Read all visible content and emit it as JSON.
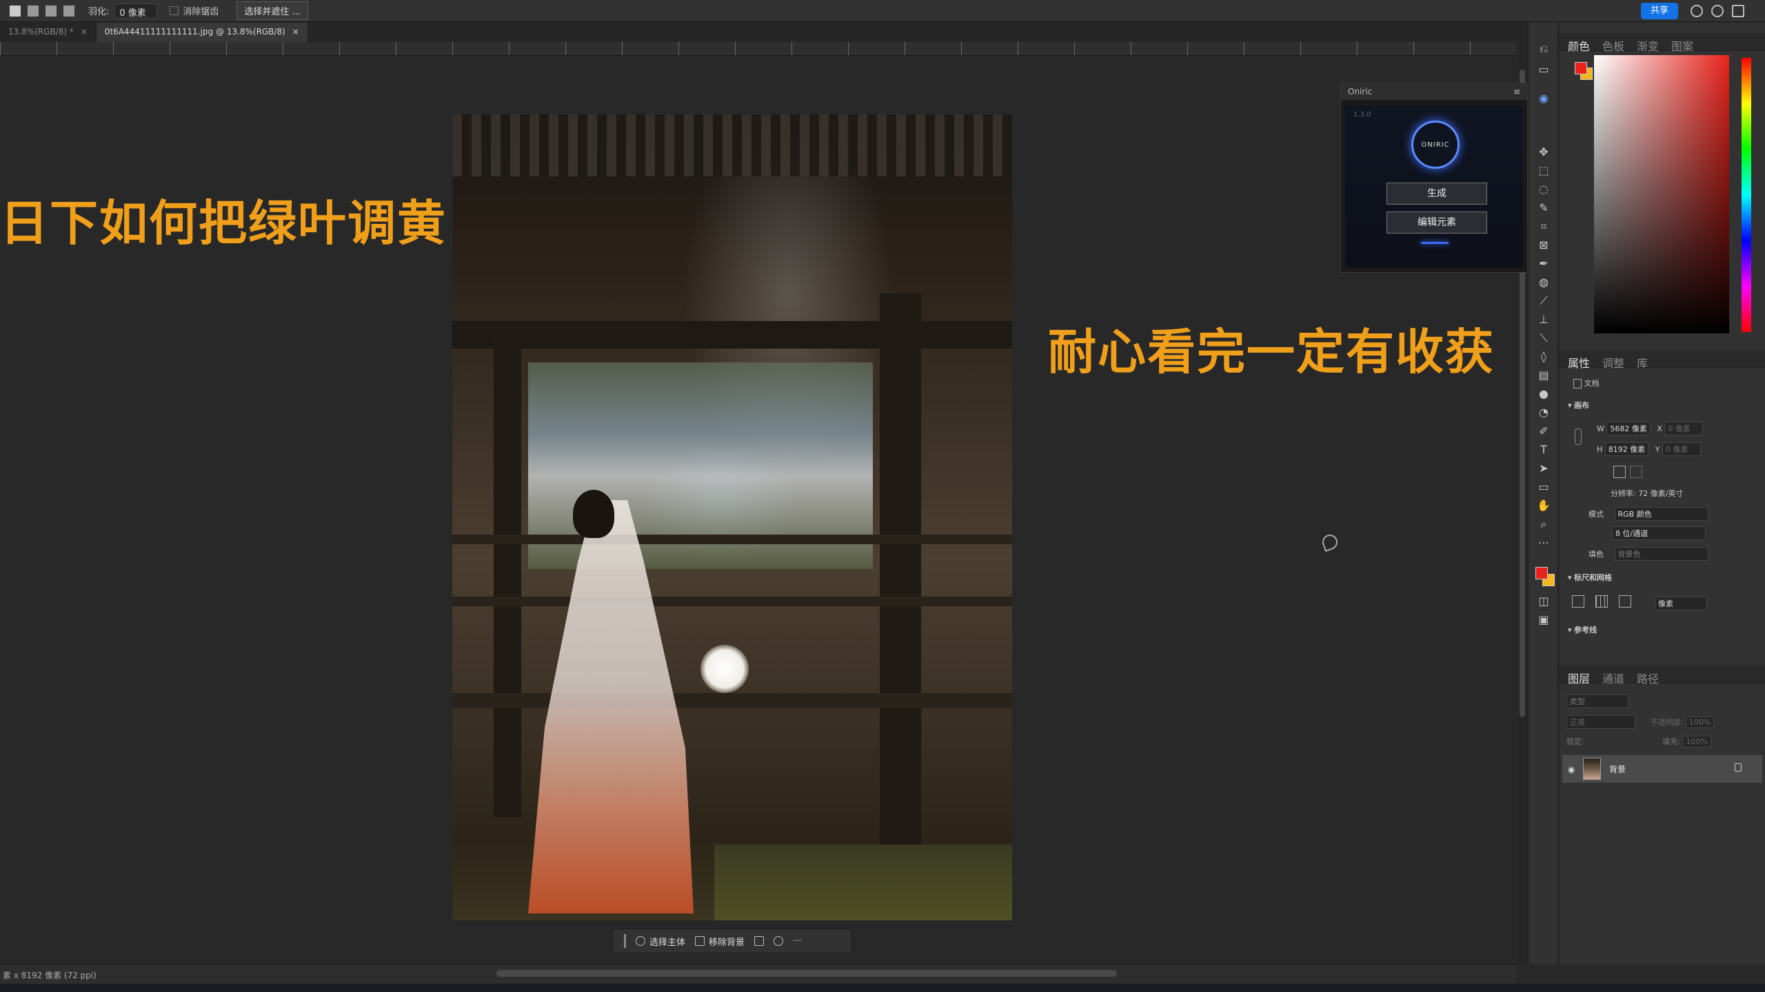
{
  "optbar": {
    "feather_label": "羽化:",
    "feather_value": "0 像素",
    "antialias_label": "消除锯齿",
    "select_mask_button": "选择并遮住 ..."
  },
  "topbar": {
    "share": "共享"
  },
  "tabs": [
    {
      "label": "13.8%(RGB/8) *",
      "close": "×"
    },
    {
      "label": "0t6A44411111111111.jpg @ 13.8%(RGB/8)",
      "close": "×"
    }
  ],
  "overlay": {
    "left_text": "日下如何把绿叶调黄",
    "right_text": "耐心看完一定有收获"
  },
  "context_bar": {
    "select_subject": "选择主体",
    "remove_bg": "移除背景",
    "more": "···"
  },
  "plugin": {
    "title": "Oniric",
    "version": "1.3.0",
    "logo_text": "ONIRIC",
    "generate": "生成",
    "edit_element": "编辑元素"
  },
  "color_panel": {
    "tabs": [
      "颜色",
      "色板",
      "渐变",
      "图案"
    ]
  },
  "properties_panel": {
    "tabs": [
      "属性",
      "调整",
      "库"
    ],
    "doc_label": "文档",
    "canvas_section": "画布",
    "w_label": "W",
    "w_value": "5682 像素",
    "x_label": "X",
    "x_placeholder": "0 像素",
    "h_label": "H",
    "h_value": "8192 像素",
    "y_label": "Y",
    "y_placeholder": "0 像素",
    "resolution": "分辨率: 72 像素/英寸",
    "mode_label": "模式",
    "mode_value": "RGB 颜色",
    "depth_value": "8 位/通道",
    "fill_label": "填色",
    "fill_value": "背景色",
    "rulers_section": "标尺和网格",
    "unit_value": "像素",
    "guides_section": "参考线"
  },
  "layers_panel": {
    "tabs": [
      "图层",
      "通道",
      "路径"
    ],
    "search_placeholder": "类型",
    "blend_mode": "正常",
    "opacity_label": "不透明度:",
    "opacity_value": "100%",
    "lock_label": "锁定:",
    "fill_label": "填充:",
    "fill_value": "100%",
    "layer_name": "背景"
  },
  "status": {
    "text": "素 x 8192 像素 (72 ppi)"
  },
  "colors": {
    "accent_text": "#f09f1b",
    "share_blue": "#1473e6",
    "foreground": "#e8231b",
    "background": "#f5b81c"
  }
}
